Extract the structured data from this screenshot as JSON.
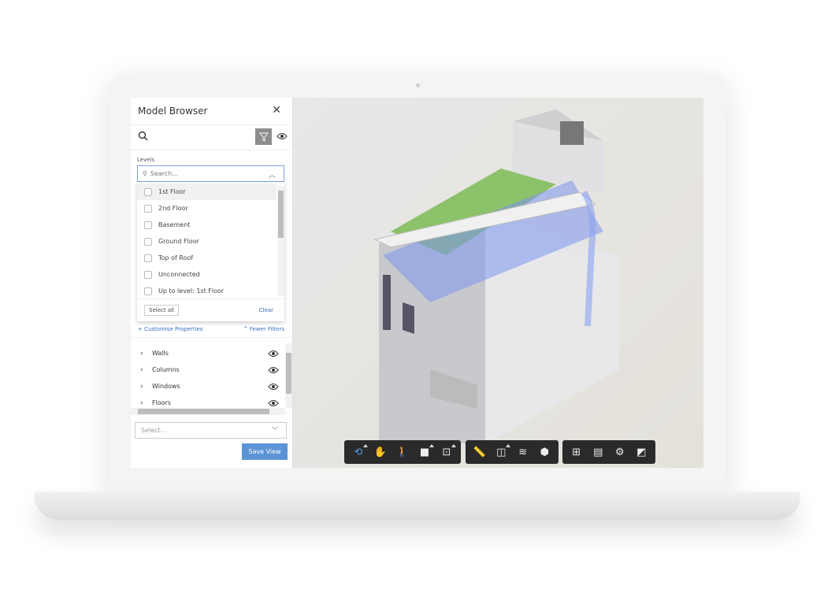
{
  "panel": {
    "title": "Model Browser",
    "levels_label": "Levels",
    "levels_search_placeholder": "Search...",
    "levels": [
      {
        "label": "1st Floor",
        "checked": false
      },
      {
        "label": "2nd Floor",
        "checked": false
      },
      {
        "label": "Basement",
        "checked": false
      },
      {
        "label": "Ground Floor",
        "checked": false
      },
      {
        "label": "Top of Roof",
        "checked": false
      },
      {
        "label": "Unconnected",
        "checked": false
      },
      {
        "label": "Up to level: 1st Floor",
        "checked": false
      }
    ],
    "select_all": "Select all",
    "clear": "Clear",
    "customise": "+ Customise Properties",
    "fewer_filters": "^ Fewer Filters",
    "categories": [
      {
        "label": "Walls"
      },
      {
        "label": "Columns"
      },
      {
        "label": "Windows"
      },
      {
        "label": "Floors"
      }
    ],
    "view_select_placeholder": "Select...",
    "save_view": "Save View"
  },
  "toolbar": {
    "groups": [
      [
        {
          "icon": "orbit-icon",
          "active": true,
          "more": true
        },
        {
          "icon": "pan-hand-icon"
        },
        {
          "icon": "first-person-icon"
        },
        {
          "icon": "camera-icon",
          "more": true
        },
        {
          "icon": "fit-view-icon",
          "more": true
        }
      ],
      [
        {
          "icon": "measure-icon"
        },
        {
          "icon": "section-box-icon",
          "more": true
        },
        {
          "icon": "layers-icon"
        },
        {
          "icon": "explode-model-icon"
        }
      ],
      [
        {
          "icon": "model-tree-icon"
        },
        {
          "icon": "properties-icon"
        },
        {
          "icon": "settings-gear-icon"
        },
        {
          "icon": "fullscreen-icon"
        }
      ]
    ]
  },
  "colors": {
    "accent": "#5b94d6",
    "link": "#3b6fc0",
    "toolbar": "#2a2a2a",
    "selection_highlight": "#6f8ff0"
  }
}
